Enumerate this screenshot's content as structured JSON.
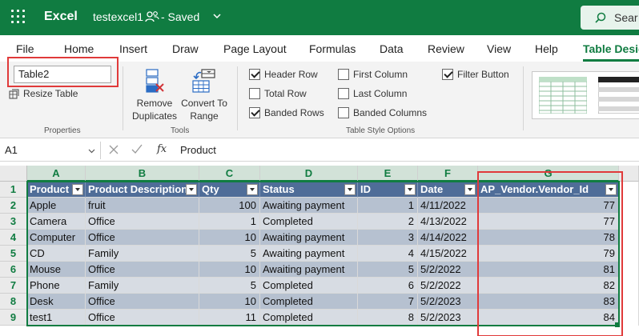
{
  "app": {
    "name": "Excel",
    "document_title": "testexcel1",
    "save_status": "- Saved",
    "search_placeholder": "Sear"
  },
  "ribbon_tabs": [
    "File",
    "Home",
    "Insert",
    "Draw",
    "Page Layout",
    "Formulas",
    "Data",
    "Review",
    "View",
    "Help",
    "Table Desig"
  ],
  "active_tab": "Table Desig",
  "properties": {
    "table_name": "Table2",
    "resize_label": "Resize Table",
    "group_label": "Properties"
  },
  "tools": {
    "remove_duplicates": "Remove Duplicates",
    "remove_duplicates_l1": "Remove",
    "remove_duplicates_l2": "Duplicates",
    "convert_l1": "Convert To",
    "convert_l2": "Range",
    "group_label": "Tools"
  },
  "style_options": {
    "group_label": "Table Style Options",
    "header_row": {
      "label": "Header Row",
      "checked": true
    },
    "total_row": {
      "label": "Total Row",
      "checked": false
    },
    "banded_rows": {
      "label": "Banded Rows",
      "checked": true
    },
    "first_column": {
      "label": "First Column",
      "checked": false
    },
    "last_column": {
      "label": "Last Column",
      "checked": false
    },
    "banded_columns": {
      "label": "Banded Columns",
      "checked": false
    },
    "filter_button": {
      "label": "Filter Button",
      "checked": true
    }
  },
  "formula_bar": {
    "name_box": "A1",
    "fx_label": "fx",
    "value": "Product"
  },
  "grid": {
    "columns": [
      "A",
      "B",
      "C",
      "D",
      "E",
      "F",
      "G"
    ],
    "rows": [
      "1",
      "2",
      "3",
      "4",
      "5",
      "6",
      "7",
      "8",
      "9"
    ],
    "headers": [
      "Product",
      "Product Description",
      "Qty",
      "Status",
      "ID",
      "Date",
      "AP_Vendor.Vendor_Id"
    ],
    "data": [
      [
        "Apple",
        "fruit",
        "100",
        "Awaiting payment",
        "1",
        "4/11/2022",
        "77"
      ],
      [
        "Camera",
        "Office",
        "1",
        "Completed",
        "2",
        "4/13/2022",
        "77"
      ],
      [
        "Computer",
        "Office",
        "10",
        "Awaiting payment",
        "3",
        "4/14/2022",
        "78"
      ],
      [
        "CD",
        "Family",
        "5",
        "Awaiting payment",
        "4",
        "4/15/2022",
        "79"
      ],
      [
        "Mouse",
        "Office",
        "10",
        "Awaiting payment",
        "5",
        "5/2/2022",
        "81"
      ],
      [
        "Phone",
        "Family",
        "5",
        "Completed",
        "6",
        "5/2/2022",
        "82"
      ],
      [
        "Desk",
        "Office",
        "10",
        "Completed",
        "7",
        "5/2/2023",
        "83"
      ],
      [
        "test1",
        "Office",
        "11",
        "Completed",
        "8",
        "5/2/2023",
        "84"
      ]
    ]
  },
  "colors": {
    "excel_green": "#107c41",
    "table_header": "#4f6d98",
    "band_dark": "#b6c1d0",
    "band_light": "#d7dce3",
    "highlight_red": "#e03a3a"
  }
}
